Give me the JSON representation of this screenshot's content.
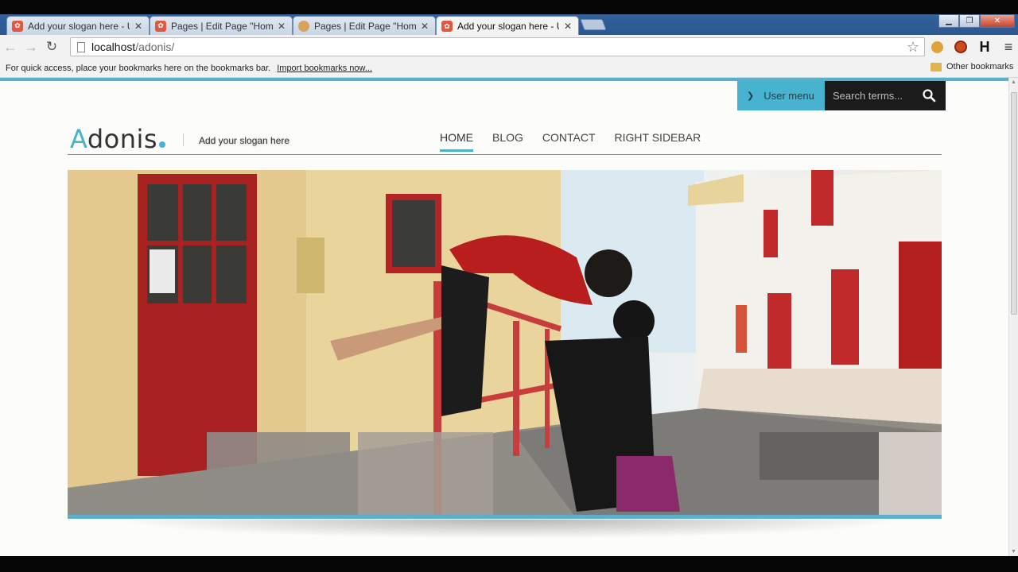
{
  "browser": {
    "tabs": [
      {
        "title": "Add your slogan here - Ur",
        "active": false
      },
      {
        "title": "Pages | Edit Page \"Home\"",
        "active": false
      },
      {
        "title": "Pages | Edit Page \"Home\"",
        "active": false
      },
      {
        "title": "Add your slogan here - Ur",
        "active": true
      }
    ],
    "url_host": "localhost",
    "url_path": "/adonis/",
    "bookmarks_message": "For quick access, place your bookmarks here on the bookmarks bar.",
    "import_link": "Import bookmarks now...",
    "other_bookmarks": "Other bookmarks",
    "extension_h": "H"
  },
  "site": {
    "logo_first": "A",
    "logo_rest": "donis",
    "slogan": "Add your slogan here",
    "user_menu": "User menu",
    "search_placeholder": "Search terms...",
    "nav": [
      {
        "label": "HOME",
        "active": true
      },
      {
        "label": "BLOG",
        "active": false
      },
      {
        "label": "CONTACT",
        "active": false
      },
      {
        "label": "RIGHT SIDEBAR",
        "active": false
      }
    ]
  },
  "colors": {
    "accent": "#47b3cf",
    "search_bg": "#1b1b1b",
    "page_bg": "#fcfcfa"
  },
  "icons": {
    "user_menu": "chevron-down-icon",
    "search": "search-icon",
    "bookmark": "star-icon"
  }
}
